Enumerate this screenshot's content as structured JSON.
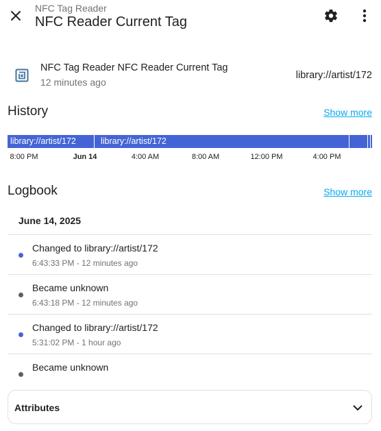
{
  "header": {
    "breadcrumb": "NFC Tag Reader",
    "title": "NFC Reader Current Tag"
  },
  "entity": {
    "name": "NFC Tag Reader NFC Reader Current Tag",
    "last_changed": "12 minutes ago",
    "state": "library://artist/172",
    "icon": "nfc-icon"
  },
  "history": {
    "title": "History",
    "show_more": "Show more",
    "segments": [
      {
        "label": "library://artist/172"
      },
      {
        "label": "library://artist/172"
      }
    ],
    "axis_ticks": [
      "8:00 PM",
      "Jun 14",
      "4:00 AM",
      "8:00 AM",
      "12:00 PM",
      "4:00 PM"
    ],
    "bar_color": "#4464d6"
  },
  "logbook": {
    "title": "Logbook",
    "show_more": "Show more",
    "date": "June 14, 2025",
    "entries": [
      {
        "message": "Changed to library://artist/172",
        "time": "6:43:33 PM - 12 minutes ago",
        "dot_color": "#4464d6"
      },
      {
        "message": "Became unknown",
        "time": "6:43:18 PM - 12 minutes ago",
        "dot_color": "#5f5f5f"
      },
      {
        "message": "Changed to library://artist/172",
        "time": "5:31:02 PM - 1 hour ago",
        "dot_color": "#4464d6"
      },
      {
        "message": "Became unknown",
        "time": "",
        "dot_color": "#5f5f5f"
      }
    ]
  },
  "attributes": {
    "label": "Attributes"
  },
  "colors": {
    "accent_link": "#03a9f4",
    "primary_text": "#212121",
    "secondary_text": "#727272",
    "icon_accent": "#44739e"
  }
}
